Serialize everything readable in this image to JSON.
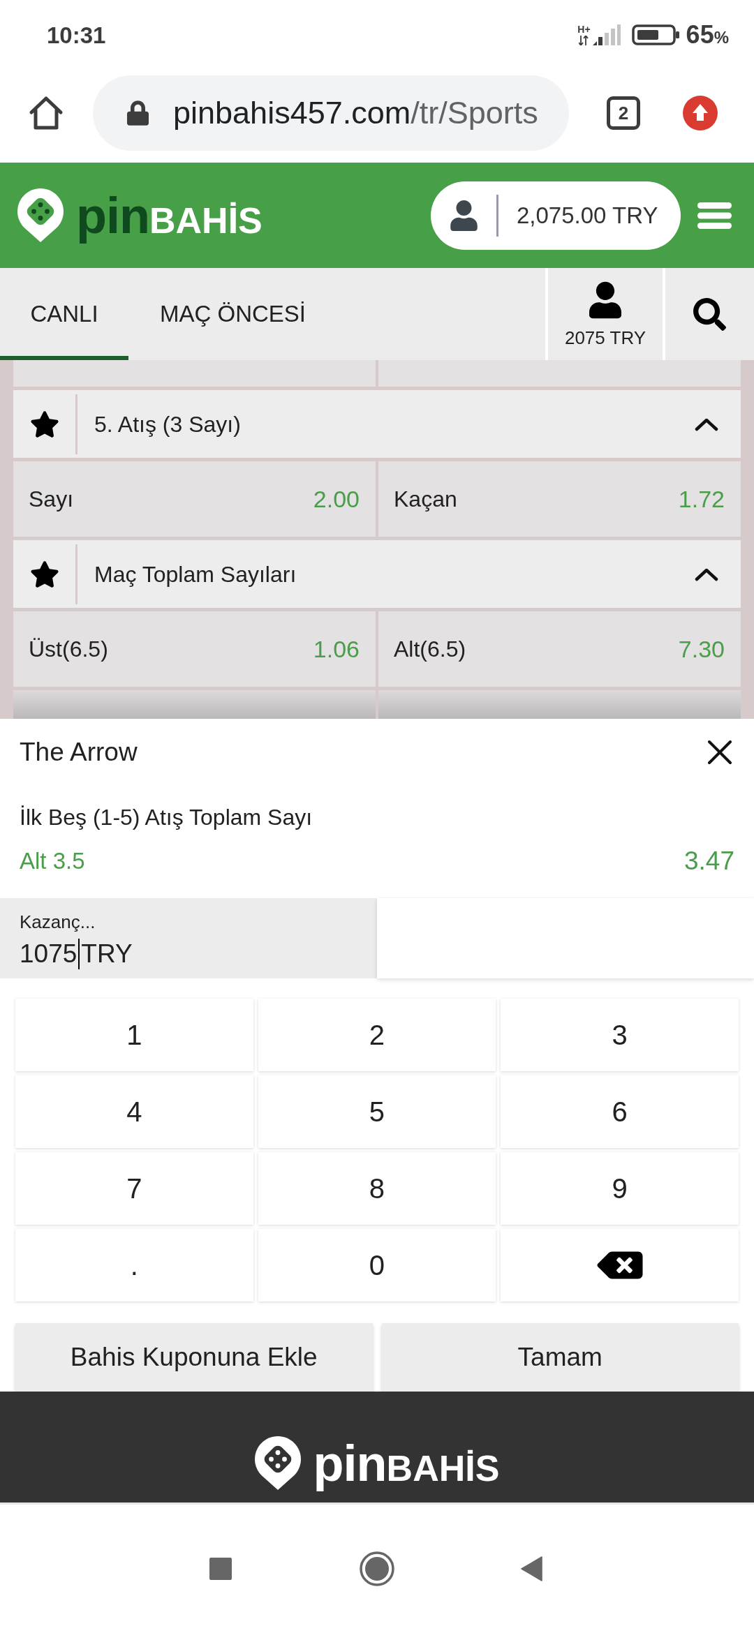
{
  "status_bar": {
    "time": "10:31",
    "network_type": "H+",
    "battery": "65",
    "battery_unit": "%"
  },
  "browser": {
    "url_host": "pinbahis457.com",
    "url_path": "/tr/Sports",
    "tab_count": "2"
  },
  "header": {
    "logo": {
      "brand_a": "pin",
      "brand_b": "BAHİS"
    },
    "balance": "2,075.00 TRY"
  },
  "tabs": [
    {
      "label": "CANLI",
      "selected": true
    },
    {
      "label": "MAÇ ÖNCESİ",
      "selected": false
    }
  ],
  "account": {
    "balance": "2075 TRY"
  },
  "markets": [
    {
      "title": "5. Atış (3 Sayı)",
      "expanded": true,
      "odds": [
        {
          "label": "Sayı",
          "price": "2.00"
        },
        {
          "label": "Kaçan",
          "price": "1.72"
        }
      ]
    },
    {
      "title": "Maç Toplam Sayıları",
      "expanded": true,
      "odds": [
        {
          "label": "Üst(6.5)",
          "price": "1.06"
        },
        {
          "label": "Alt(6.5)",
          "price": "7.30"
        }
      ]
    }
  ],
  "bet_slip": {
    "event": "The Arrow",
    "market": "İlk Beş (1-5) Atış Toplam Sayı",
    "selection": "Alt 3.5",
    "price": "3.47",
    "stake": {
      "label": "Kazanç...",
      "value": "1075",
      "currency": "TRY"
    }
  },
  "keypad": [
    {
      "kind": "key",
      "label": "1"
    },
    {
      "kind": "key",
      "label": "2"
    },
    {
      "kind": "key",
      "label": "3"
    },
    {
      "kind": "key",
      "label": "4"
    },
    {
      "kind": "key",
      "label": "5"
    },
    {
      "kind": "key",
      "label": "6"
    },
    {
      "kind": "key",
      "label": "7"
    },
    {
      "kind": "key",
      "label": "8"
    },
    {
      "kind": "key",
      "label": "9"
    },
    {
      "kind": "key",
      "label": "."
    },
    {
      "kind": "key",
      "label": "0"
    },
    {
      "kind": "backspace"
    }
  ],
  "actions": [
    {
      "label": "Bahis Kuponuna Ekle"
    },
    {
      "label": "Tamam"
    }
  ],
  "footer": {
    "logo": {
      "brand_a": "pin",
      "brand_b": "BAHİS"
    }
  }
}
